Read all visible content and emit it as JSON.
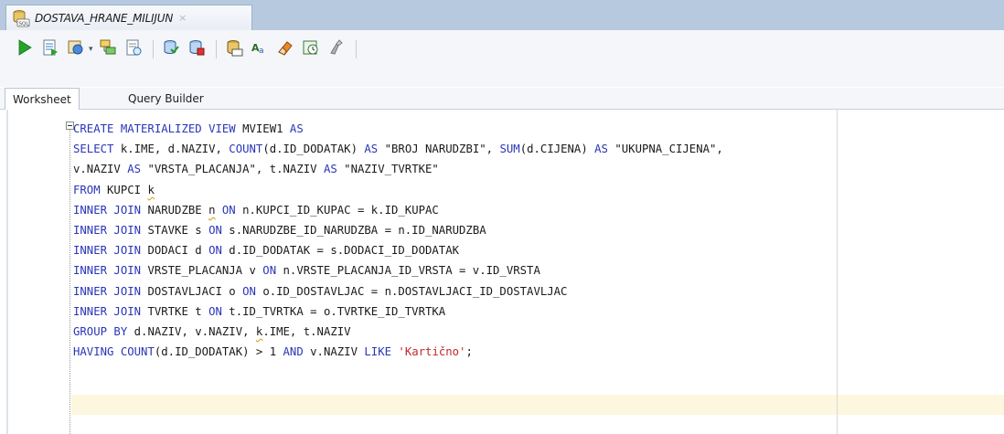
{
  "document_tab": {
    "title": "DOSTAVA_HRANE_MILIJUN",
    "close_glyph": "×",
    "icon": "sql-database-icon"
  },
  "toolbar": {
    "buttons": [
      {
        "icon": "run-statement-icon"
      },
      {
        "icon": "run-script-icon"
      },
      {
        "icon": "autotrace-icon"
      },
      {
        "icon": "dropdown-chevron-icon"
      },
      {
        "icon": "explain-plan-icon"
      },
      {
        "icon": "sql-tuning-icon"
      },
      {
        "icon": "commit-icon"
      },
      {
        "icon": "rollback-icon"
      },
      {
        "icon": "unshared-sql-icon"
      },
      {
        "icon": "to-upper-lower-icon"
      },
      {
        "icon": "clear-eraser-icon"
      },
      {
        "icon": "sql-history-icon"
      },
      {
        "icon": "format-icon"
      }
    ],
    "dropdown_glyph": "▾"
  },
  "subtabs": {
    "worksheet": "Worksheet",
    "query_builder": "Query Builder"
  },
  "editor": {
    "lines": [
      [
        {
          "t": "CREATE MATERIALIZED VIEW ",
          "c": "kw"
        },
        {
          "t": "MVIEW1 ",
          "c": ""
        },
        {
          "t": "AS",
          "c": "kw"
        }
      ],
      [
        {
          "t": "SELECT ",
          "c": "kw"
        },
        {
          "t": "k.IME, d.NAZIV, ",
          "c": ""
        },
        {
          "t": "COUNT",
          "c": "fn"
        },
        {
          "t": "(d.ID_DODATAK) ",
          "c": ""
        },
        {
          "t": "AS ",
          "c": "kw"
        },
        {
          "t": "\"BROJ NARUDZBI\"",
          "c": ""
        },
        {
          "t": ", ",
          "c": ""
        },
        {
          "t": "SUM",
          "c": "fn"
        },
        {
          "t": "(d.CIJENA) ",
          "c": ""
        },
        {
          "t": "AS ",
          "c": "kw"
        },
        {
          "t": "\"UKUPNA_CIJENA\",",
          "c": ""
        }
      ],
      [
        {
          "t": "v.NAZIV ",
          "c": ""
        },
        {
          "t": "AS ",
          "c": "kw"
        },
        {
          "t": "\"VRSTA_PLACANJA\", t.NAZIV ",
          "c": ""
        },
        {
          "t": "AS ",
          "c": "kw"
        },
        {
          "t": "\"NAZIV_TVRTKE\"",
          "c": ""
        }
      ],
      [
        {
          "t": "FROM ",
          "c": "kw"
        },
        {
          "t": "KUPCI ",
          "c": ""
        },
        {
          "t": "k",
          "c": "sq"
        }
      ],
      [
        {
          "t": "INNER JOIN ",
          "c": "kw"
        },
        {
          "t": "NARUDZBE ",
          "c": ""
        },
        {
          "t": "n",
          "c": "sq"
        },
        {
          "t": " ",
          "c": ""
        },
        {
          "t": "ON ",
          "c": "kw"
        },
        {
          "t": "n.KUPCI_ID_KUPAC = k.ID_KUPAC",
          "c": ""
        }
      ],
      [
        {
          "t": "INNER JOIN ",
          "c": "kw"
        },
        {
          "t": "STAVKE s ",
          "c": ""
        },
        {
          "t": "ON ",
          "c": "kw"
        },
        {
          "t": "s.NARUDZBE_ID_NARUDZBA = n.ID_NARUDZBA",
          "c": ""
        }
      ],
      [
        {
          "t": "INNER JOIN ",
          "c": "kw"
        },
        {
          "t": "DODACI d ",
          "c": ""
        },
        {
          "t": "ON ",
          "c": "kw"
        },
        {
          "t": "d.ID_DODATAK = s.DODACI_ID_DODATAK",
          "c": ""
        }
      ],
      [
        {
          "t": "INNER JOIN ",
          "c": "kw"
        },
        {
          "t": "VRSTE_PLACANJA v ",
          "c": ""
        },
        {
          "t": "ON ",
          "c": "kw"
        },
        {
          "t": "n.VRSTE_PLACANJA_ID_VRSTA = v.ID_VRSTA",
          "c": ""
        }
      ],
      [
        {
          "t": "INNER JOIN ",
          "c": "kw"
        },
        {
          "t": "DOSTAVLJACI o ",
          "c": ""
        },
        {
          "t": "ON ",
          "c": "kw"
        },
        {
          "t": "o.ID_DOSTAVLJAC = n.DOSTAVLJACI_ID_DOSTAVLJAC",
          "c": ""
        }
      ],
      [
        {
          "t": "INNER JOIN ",
          "c": "kw"
        },
        {
          "t": "TVRTKE t ",
          "c": ""
        },
        {
          "t": "ON ",
          "c": "kw"
        },
        {
          "t": "t.ID_TVRTKA = o.TVRTKE_ID_TVRTKA",
          "c": ""
        }
      ],
      [
        {
          "t": "GROUP BY ",
          "c": "kw"
        },
        {
          "t": "d.NAZIV, v.NAZIV, ",
          "c": ""
        },
        {
          "t": "k",
          "c": "sq"
        },
        {
          "t": ".IME, t.NAZIV",
          "c": ""
        }
      ],
      [
        {
          "t": "HAVING ",
          "c": "kw"
        },
        {
          "t": "COUNT",
          "c": "fn"
        },
        {
          "t": "(d.ID_DODATAK) > 1 ",
          "c": ""
        },
        {
          "t": "AND ",
          "c": "kw"
        },
        {
          "t": "v.NAZIV ",
          "c": ""
        },
        {
          "t": "LIKE ",
          "c": "kw"
        },
        {
          "t": "'Kartično'",
          "c": "str"
        },
        {
          "t": ";",
          "c": ""
        }
      ]
    ]
  },
  "colors": {
    "keyword": "#2a35b8",
    "string": "#c3282a",
    "current_line": "#fdf7df",
    "tabstrip": "#b7c9df"
  }
}
